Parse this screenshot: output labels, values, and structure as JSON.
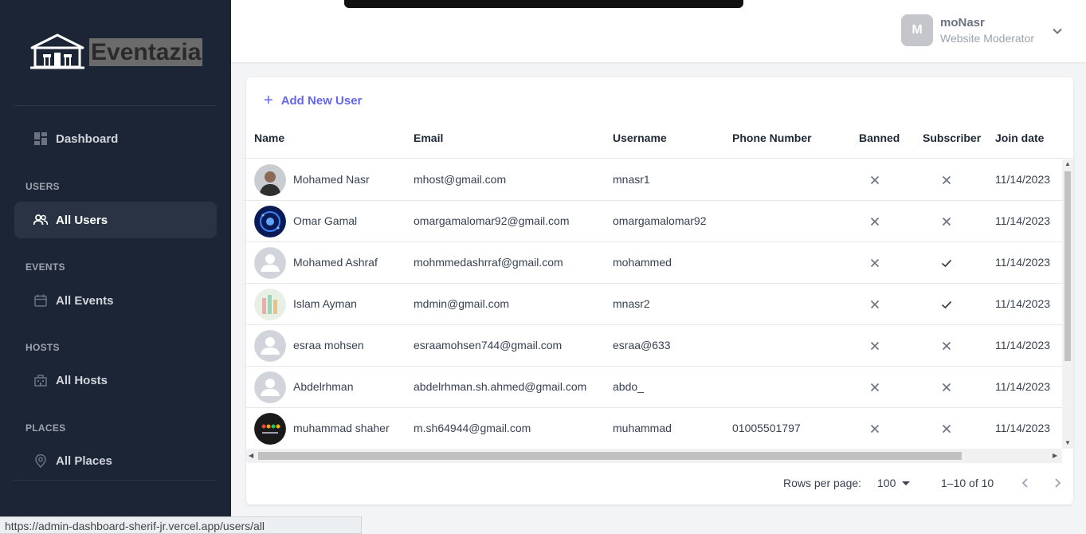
{
  "brand": {
    "name": "Eventazia"
  },
  "sidebar": {
    "dashboard": {
      "label": "Dashboard"
    },
    "sections": [
      {
        "title": "USERS",
        "item": "All Users"
      },
      {
        "title": "EVENTS",
        "item": "All Events"
      },
      {
        "title": "HOSTS",
        "item": "All Hosts"
      },
      {
        "title": "PLACES",
        "item": "All Places"
      }
    ]
  },
  "header": {
    "avatar_letter": "M",
    "user_name": "moNasr",
    "user_role": "Website Moderator"
  },
  "toolbar": {
    "add_label": "Add New User"
  },
  "table": {
    "columns": [
      "Name",
      "Email",
      "Username",
      "Phone Number",
      "Banned",
      "Subscriber",
      "Join date"
    ],
    "rows": [
      {
        "name": "Mohamed Nasr",
        "email": "mhost@gmail.com",
        "username": "mnasr1",
        "phone": "",
        "banned": false,
        "subscriber": false,
        "join": "11/14/2023",
        "avatar": "photo-man"
      },
      {
        "name": "Omar Gamal",
        "email": "omargamalomar92@gmail.com",
        "username": "omargamalomar92",
        "phone": "",
        "banned": false,
        "subscriber": false,
        "join": "11/14/2023",
        "avatar": "photo-blue"
      },
      {
        "name": "Mohamed Ashraf",
        "email": "mohmmedashrraf@gmail.com",
        "username": "mohammed",
        "phone": "",
        "banned": false,
        "subscriber": true,
        "join": "11/14/2023",
        "avatar": "default"
      },
      {
        "name": "Islam Ayman",
        "email": "mdmin@gmail.com",
        "username": "mnasr2",
        "phone": "",
        "banned": false,
        "subscriber": true,
        "join": "11/14/2023",
        "avatar": "photo-art"
      },
      {
        "name": "esraa mohsen",
        "email": "esraamohsen744@gmail.com",
        "username": "esraa@633",
        "phone": "",
        "banned": false,
        "subscriber": false,
        "join": "11/14/2023",
        "avatar": "default"
      },
      {
        "name": "Abdelrhman",
        "email": "abdelrhman.sh.ahmed@gmail.com",
        "username": "abdo_",
        "phone": "",
        "banned": false,
        "subscriber": false,
        "join": "11/14/2023",
        "avatar": "default"
      },
      {
        "name": "muhammad shaher",
        "email": "m.sh64944@gmail.com",
        "username": "muhammad",
        "phone": "01005501797",
        "banned": false,
        "subscriber": false,
        "join": "11/14/2023",
        "avatar": "photo-dark"
      }
    ]
  },
  "pagination": {
    "rows_per_page_label": "Rows per page:",
    "rows_per_page": "100",
    "range": "1–10 of 10"
  },
  "status_url": "https://admin-dashboard-sherif-jr.vercel.app/users/all",
  "colors": {
    "sidebar": "#1c2536",
    "accent": "#6366f1"
  }
}
